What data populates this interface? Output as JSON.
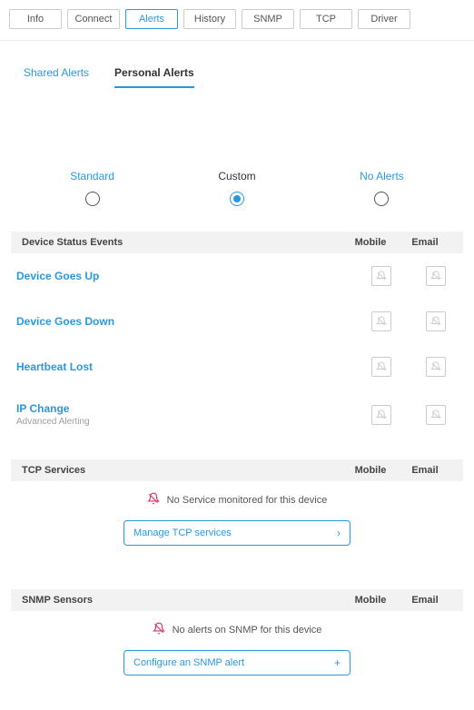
{
  "top_tabs": {
    "info": "Info",
    "connect": "Connect",
    "alerts": "Alerts",
    "history": "History",
    "snmp": "SNMP",
    "tcp": "TCP",
    "driver": "Driver",
    "active": "alerts"
  },
  "sub_tabs": {
    "shared": "Shared Alerts",
    "personal": "Personal Alerts",
    "active": "personal"
  },
  "profiles": {
    "standard": "Standard",
    "custom": "Custom",
    "noalerts": "No Alerts",
    "selected": "custom"
  },
  "cols": {
    "mobile": "Mobile",
    "email": "Email"
  },
  "device_status": {
    "title": "Device Status Events",
    "events": [
      {
        "name": "Device Goes Up",
        "sub": ""
      },
      {
        "name": "Device Goes Down",
        "sub": ""
      },
      {
        "name": "Heartbeat Lost",
        "sub": ""
      },
      {
        "name": "IP Change",
        "sub": "Advanced Alerting"
      }
    ]
  },
  "tcp": {
    "title": "TCP Services",
    "empty_msg": "No Service monitored for this device",
    "action": "Manage TCP services"
  },
  "snmp_sensors": {
    "title": "SNMP Sensors",
    "empty_msg": "No alerts on SNMP for this device",
    "action": "Configure an SNMP alert"
  },
  "icons": {
    "bell_off": "bell-off",
    "chevron_right": "›",
    "plus": "+"
  }
}
